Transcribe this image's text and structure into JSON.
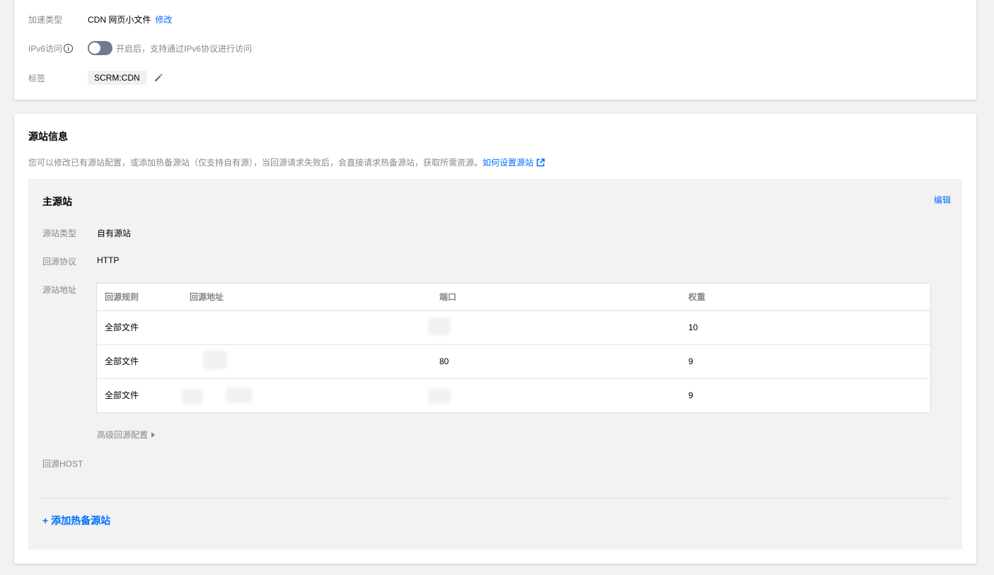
{
  "basic": {
    "accel_label": "加速类型",
    "accel_value": "CDN 网页小文件",
    "accel_modify": "修改",
    "ipv6_label": "IPv6访问",
    "ipv6_enabled": false,
    "ipv6_desc": "开启后，支持通过IPv6协议进行访问",
    "tag_label": "标签",
    "tag_value": "SCRM:CDN"
  },
  "origin": {
    "title": "源站信息",
    "desc": "您可以修改已有源站配置，或添加热备源站（仅支持自有源），当回源请求失败后，会直接请求热备源站，获取所需资源。",
    "help_link": "如何设置源站",
    "primary": {
      "title": "主源站",
      "edit": "编辑",
      "type_label": "源站类型",
      "type_value": "自有源站",
      "protocol_label": "回源协议",
      "protocol_value": "HTTP",
      "address_label": "源站地址",
      "table": {
        "headers": [
          "回源规则",
          "回源地址",
          "端口",
          "权重"
        ],
        "rows": [
          {
            "rule": "全部文件",
            "address": "",
            "port": "",
            "weight": "10"
          },
          {
            "rule": "全部文件",
            "address": "",
            "port": "80",
            "weight": "9"
          },
          {
            "rule": "全部文件",
            "address": "",
            "port": "",
            "weight": "9"
          }
        ]
      },
      "advanced": "高级回源配置",
      "host_label": "回源HOST"
    },
    "add_hot": "+ 添加热备源站"
  },
  "colors": {
    "accent": "#006eff",
    "toggle_off": "#6c7d91",
    "muted_text": "#888888",
    "page_bg": "#f2f2f2"
  },
  "icons": [
    "info-icon",
    "pencil-icon",
    "external-link-icon",
    "caret-right-icon"
  ]
}
